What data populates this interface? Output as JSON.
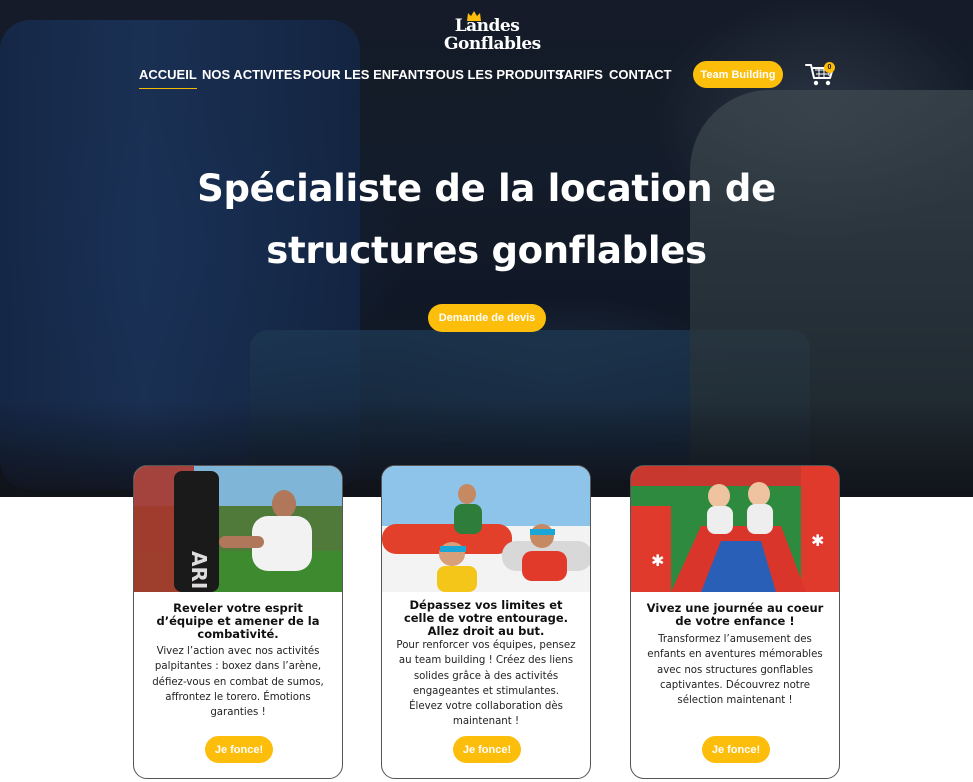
{
  "brand": {
    "logo_line1": "Landes",
    "logo_line2": "Gonflables",
    "accent_color": "#fdbd0b"
  },
  "nav": {
    "items": [
      {
        "label": "ACCUEIL",
        "active": true
      },
      {
        "label": "NOS ACTIVITES",
        "active": false
      },
      {
        "label": "POUR LES ENFANTS",
        "active": false
      },
      {
        "label": "TOUS LES PRODUITS",
        "active": false
      },
      {
        "label": "TARIFS",
        "active": false
      },
      {
        "label": "CONTACT",
        "active": false
      }
    ],
    "team_building_label": "Team Building",
    "cart_count": "0",
    "cart_icon": "shopping-cart-icon"
  },
  "hero": {
    "title_line1": "Spécialiste de la location de",
    "title_line2": "structures gonflables",
    "cta_label": "Demande de devis"
  },
  "cards": [
    {
      "title": "Reveler votre esprit d’équipe et amener de la combativité.",
      "text": "Vivez l’action avec nos activités palpitantes : boxez dans l’arène, défiez-vous en combat de sumos, affrontez le torero. Émotions garanties !",
      "button": "Je fonce!",
      "image": "boxing-bag-photo"
    },
    {
      "title": "Dépassez vos limites et celle de votre entourage. Allez droit au but.",
      "text": "Pour renforcer vos équipes, pensez au team building ! Créez des liens solides grâce à des activités engageantes et stimulantes. Élevez votre collaboration dès maintenant !",
      "button": "Je fonce!",
      "image": "inflatable-team-photo"
    },
    {
      "title": "Vivez une journée au coeur de votre enfance !",
      "text": "Transformez l’amusement des enfants en aventures mémorables avec nos structures gonflables captivantes. Découvrez notre sélection maintenant !",
      "button": "Je fonce!",
      "image": "kids-slide-photo"
    }
  ]
}
